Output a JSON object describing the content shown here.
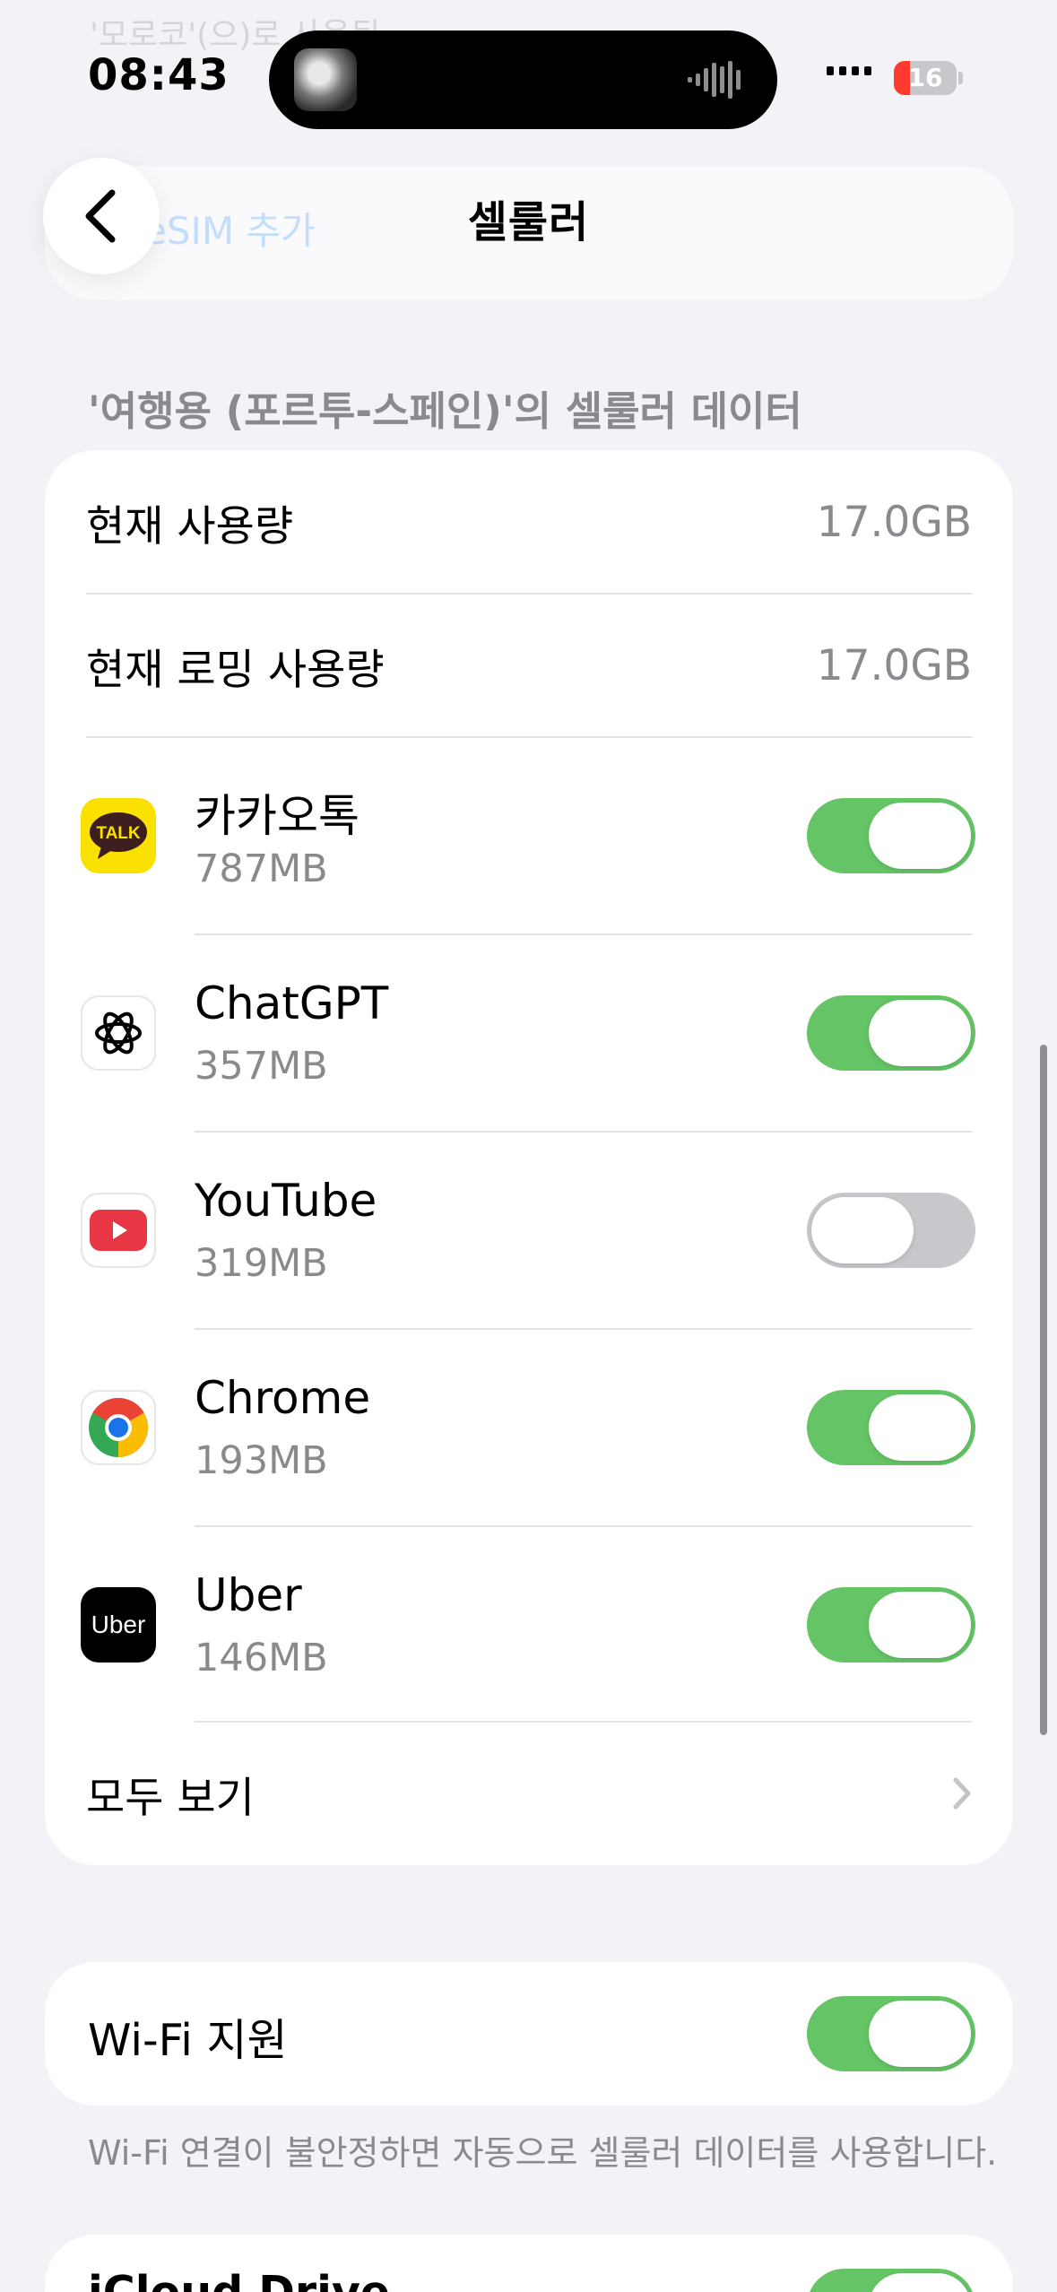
{
  "status_bar": {
    "time": "08:43",
    "battery_level": "16",
    "battery_color": "#ff3b30"
  },
  "background": {
    "faded_top_text": "'모로코'(으)로 사용됨",
    "faded_link_text": "eSIM 추가"
  },
  "nav": {
    "back_icon": "chevron-left-icon",
    "title": "셀룰러"
  },
  "cellular_data": {
    "section_header": "'여행용 (포르투-스페인)'의 셀룰러 데이터",
    "current_usage_label": "현재 사용량",
    "current_usage_value": "17.0GB",
    "roaming_usage_label": "현재 로밍 사용량",
    "roaming_usage_value": "17.0GB",
    "apps": [
      {
        "name": "카카오톡",
        "size": "787MB",
        "icon": "kakaotalk-icon",
        "icon_text": "TALK",
        "enabled": true
      },
      {
        "name": "ChatGPT",
        "size": "357MB",
        "icon": "chatgpt-icon",
        "enabled": true
      },
      {
        "name": "YouTube",
        "size": "319MB",
        "icon": "youtube-icon",
        "enabled": false
      },
      {
        "name": "Chrome",
        "size": "193MB",
        "icon": "chrome-icon",
        "enabled": true
      },
      {
        "name": "Uber",
        "size": "146MB",
        "icon": "uber-icon",
        "icon_text": "Uber",
        "enabled": true
      }
    ],
    "see_all_label": "모두 보기"
  },
  "wifi_assist": {
    "label": "Wi-Fi 지원",
    "enabled": true,
    "footer": "Wi-Fi 연결이 불안정하면 자동으로 셀룰러 데이터를 사용합니다."
  },
  "next_row": {
    "label": "iCloud Drive",
    "enabled": true
  },
  "colors": {
    "toggle_on": "#65c466",
    "toggle_off": "#c8c8cc",
    "secondary_text": "#8a8a8e",
    "background": "#f2f2f7"
  }
}
